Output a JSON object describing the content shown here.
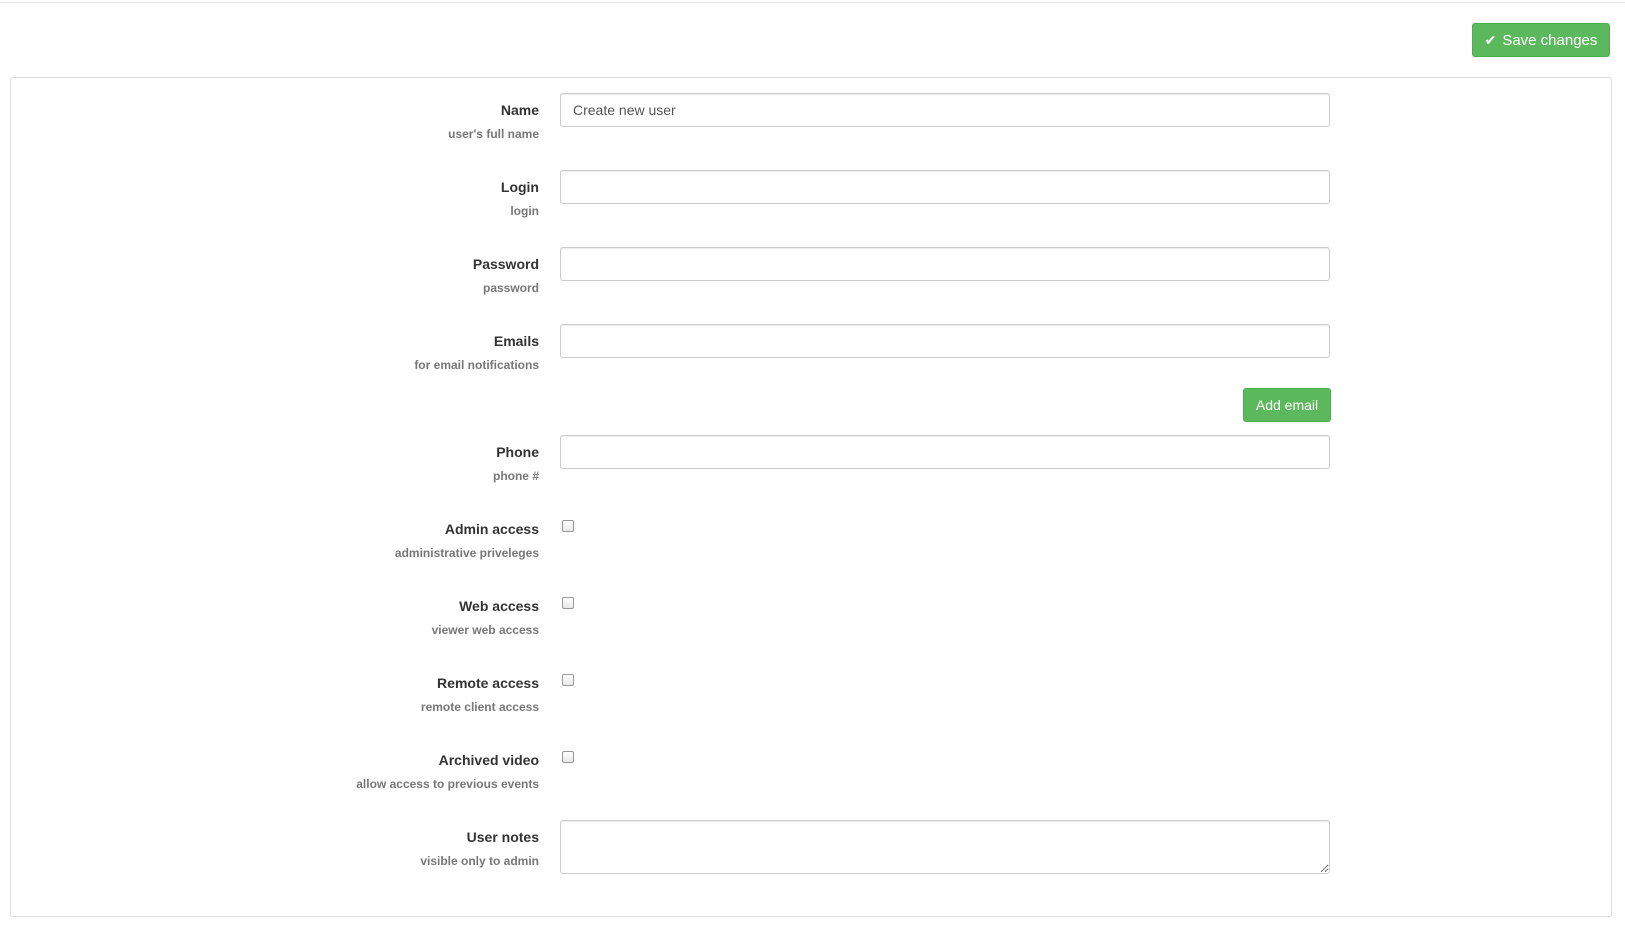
{
  "header": {
    "save_label": "Save changes",
    "save_icon": "check-icon"
  },
  "colors": {
    "success": "#5cb85c",
    "label": "#333333",
    "hint": "#777777",
    "border": "#cccccc"
  },
  "form": {
    "name": {
      "label": "Name",
      "hint": "user's full name",
      "value": "Create new user"
    },
    "login": {
      "label": "Login",
      "hint": "login",
      "value": ""
    },
    "password": {
      "label": "Password",
      "hint": "password",
      "value": ""
    },
    "emails": {
      "label": "Emails",
      "hint": "for email notifications",
      "value": "",
      "add_label": "Add email"
    },
    "phone": {
      "label": "Phone",
      "hint": "phone #",
      "value": ""
    },
    "admin_access": {
      "label": "Admin access",
      "hint": "administrative priveleges",
      "checked": false
    },
    "web_access": {
      "label": "Web access",
      "hint": "viewer web access",
      "checked": false
    },
    "remote_access": {
      "label": "Remote access",
      "hint": "remote client access",
      "checked": false
    },
    "archived_video": {
      "label": "Archived video",
      "hint": "allow access to previous events",
      "checked": false
    },
    "user_notes": {
      "label": "User notes",
      "hint": "visible only to admin",
      "value": ""
    }
  }
}
